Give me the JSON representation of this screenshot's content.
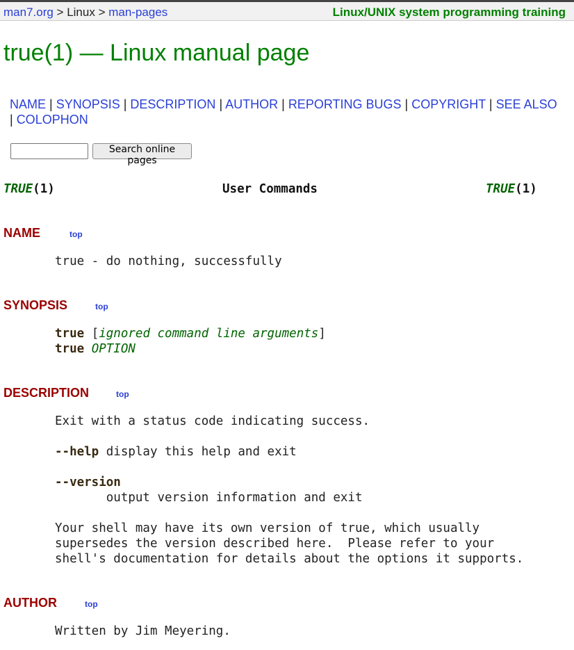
{
  "breadcrumb": {
    "home": "man7.org",
    "sep1": " > ",
    "linux": "Linux",
    "sep2": " > ",
    "manpages": "man-pages"
  },
  "training_link": "Linux/UNIX system programming training",
  "page_title": "true(1) — Linux manual page",
  "toc": {
    "items": [
      "NAME",
      "SYNOPSIS",
      "DESCRIPTION",
      "AUTHOR",
      "REPORTING BUGS",
      "COPYRIGHT",
      "SEE ALSO",
      "COLOPHON"
    ],
    "sep": " | "
  },
  "search": {
    "input_value": "",
    "button_label": "Search online pages"
  },
  "man_header": {
    "left_name": "TRUE",
    "left_sect": "(1)",
    "center": "User Commands",
    "right_name": "TRUE",
    "right_sect": "(1)"
  },
  "top_label": "top",
  "sections": {
    "name": {
      "title": "NAME",
      "text": "true - do nothing, successfully"
    },
    "synopsis": {
      "title": "SYNOPSIS",
      "line1_cmd": "true",
      "line1_open": " [",
      "line1_arg": "ignored command line arguments",
      "line1_close": "]",
      "line2_cmd": "true",
      "line2_sp": " ",
      "line2_arg": "OPTION"
    },
    "description": {
      "title": "DESCRIPTION",
      "p1": "Exit with a status code indicating success.",
      "help_opt": "--help",
      "help_text": " display this help and exit",
      "version_opt": "--version",
      "version_text": "       output version information and exit",
      "p_shell1": "Your shell may have its own version of true, which usually",
      "p_shell2": "supersedes the version described here.  Please refer to your",
      "p_shell3": "shell's documentation for details about the options it supports."
    },
    "author": {
      "title": "AUTHOR",
      "text": "Written by Jim Meyering."
    }
  },
  "colors": {
    "title_green": "#008000",
    "section_red": "#9b0000",
    "link_blue": "#2a3fd6"
  }
}
